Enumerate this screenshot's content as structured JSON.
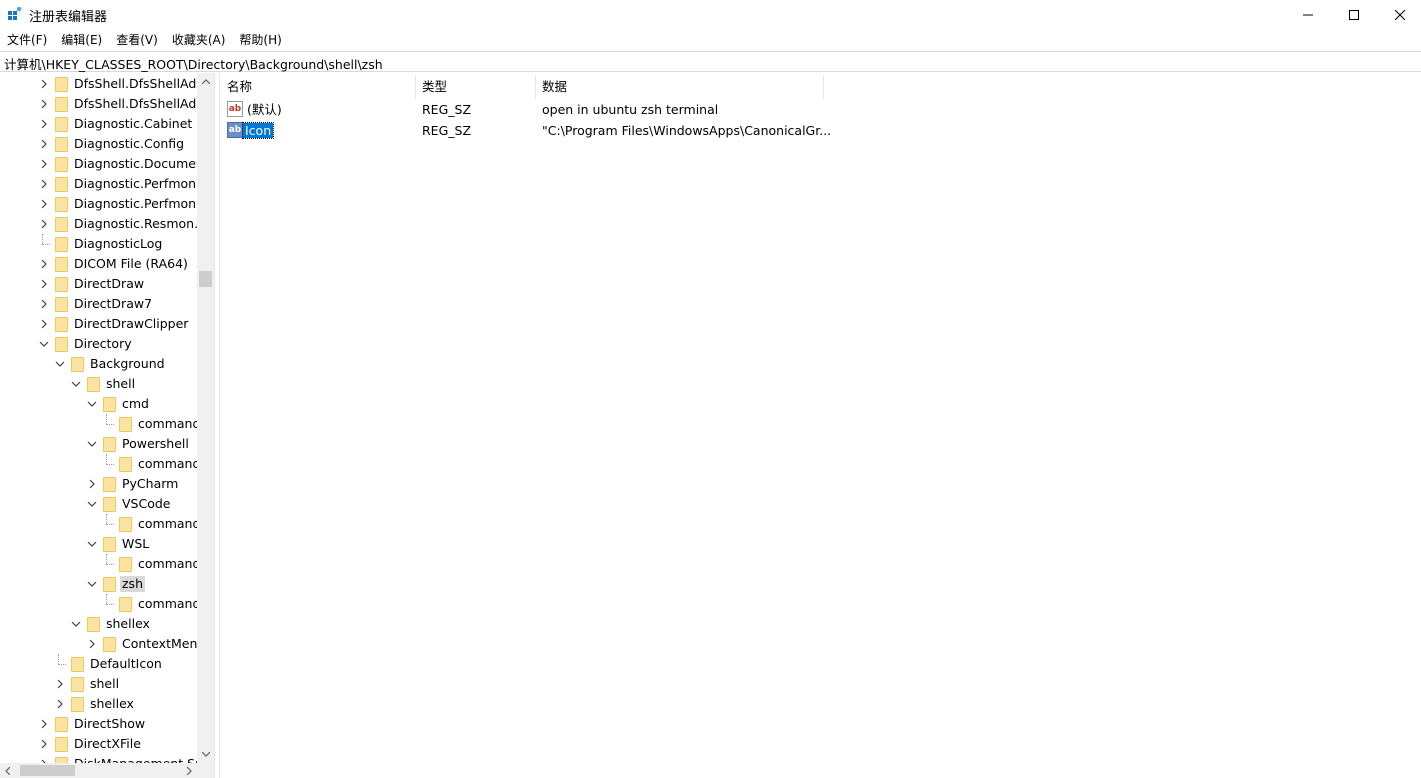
{
  "window": {
    "title": "注册表编辑器"
  },
  "menu": [
    {
      "label": "文件(F)"
    },
    {
      "label": "编辑(E)"
    },
    {
      "label": "查看(V)"
    },
    {
      "label": "收藏夹(A)"
    },
    {
      "label": "帮助(H)"
    }
  ],
  "address": {
    "path": "计算机\\HKEY_CLASSES_ROOT\\Directory\\Background\\shell\\zsh"
  },
  "tree": {
    "items": [
      {
        "label": "DfsShell.DfsShellAdm",
        "depth": 0,
        "expander": "collapsed"
      },
      {
        "label": "DfsShell.DfsShellAdm",
        "depth": 0,
        "expander": "collapsed"
      },
      {
        "label": "Diagnostic.Cabinet",
        "depth": 0,
        "expander": "collapsed"
      },
      {
        "label": "Diagnostic.Config",
        "depth": 0,
        "expander": "collapsed"
      },
      {
        "label": "Diagnostic.Document",
        "depth": 0,
        "expander": "collapsed"
      },
      {
        "label": "Diagnostic.Perfmon.C",
        "depth": 0,
        "expander": "collapsed"
      },
      {
        "label": "Diagnostic.Perfmon.D",
        "depth": 0,
        "expander": "collapsed"
      },
      {
        "label": "Diagnostic.Resmon.C",
        "depth": 0,
        "expander": "collapsed"
      },
      {
        "label": "DiagnosticLog",
        "depth": 0,
        "expander": "none"
      },
      {
        "label": "DICOM File (RA64)",
        "depth": 0,
        "expander": "collapsed"
      },
      {
        "label": "DirectDraw",
        "depth": 0,
        "expander": "collapsed"
      },
      {
        "label": "DirectDraw7",
        "depth": 0,
        "expander": "collapsed"
      },
      {
        "label": "DirectDrawClipper",
        "depth": 0,
        "expander": "collapsed"
      },
      {
        "label": "Directory",
        "depth": 0,
        "expander": "expanded"
      },
      {
        "label": "Background",
        "depth": 1,
        "expander": "expanded"
      },
      {
        "label": "shell",
        "depth": 2,
        "expander": "expanded"
      },
      {
        "label": "cmd",
        "depth": 3,
        "expander": "expanded"
      },
      {
        "label": "command",
        "depth": 4,
        "expander": "none"
      },
      {
        "label": "Powershell",
        "depth": 3,
        "expander": "expanded"
      },
      {
        "label": "command",
        "depth": 4,
        "expander": "none"
      },
      {
        "label": "PyCharm",
        "depth": 3,
        "expander": "collapsed"
      },
      {
        "label": "VSCode",
        "depth": 3,
        "expander": "expanded"
      },
      {
        "label": "command",
        "depth": 4,
        "expander": "none"
      },
      {
        "label": "WSL",
        "depth": 3,
        "expander": "expanded"
      },
      {
        "label": "command",
        "depth": 4,
        "expander": "none"
      },
      {
        "label": "zsh",
        "depth": 3,
        "expander": "expanded",
        "selected": true
      },
      {
        "label": "command",
        "depth": 4,
        "expander": "none"
      },
      {
        "label": "shellex",
        "depth": 2,
        "expander": "expanded"
      },
      {
        "label": "ContextMenu",
        "depth": 3,
        "expander": "collapsed"
      },
      {
        "label": "DefaultIcon",
        "depth": 1,
        "expander": "none"
      },
      {
        "label": "shell",
        "depth": 1,
        "expander": "collapsed"
      },
      {
        "label": "shellex",
        "depth": 1,
        "expander": "collapsed"
      },
      {
        "label": "DirectShow",
        "depth": 0,
        "expander": "collapsed"
      },
      {
        "label": "DirectXFile",
        "depth": 0,
        "expander": "collapsed"
      },
      {
        "label": "DiskManagement.Sna",
        "depth": 0,
        "expander": "collapsed"
      }
    ]
  },
  "list": {
    "columns": [
      {
        "label": "名称"
      },
      {
        "label": "类型"
      },
      {
        "label": "数据"
      }
    ],
    "rows": [
      {
        "icon": "ab",
        "name": "(默认)",
        "type": "REG_SZ",
        "data": "open in ubuntu zsh terminal",
        "selected": false
      },
      {
        "icon": "ab",
        "name": "Icon",
        "type": "REG_SZ",
        "data": "\"C:\\Program Files\\WindowsApps\\CanonicalGr...",
        "selected": true
      }
    ]
  },
  "colors": {
    "selection_blue": "#0078d7",
    "tree_selection": "#d9d9d9",
    "folder_fill": "#fbe4a1",
    "icon_red": "#c0392b"
  }
}
